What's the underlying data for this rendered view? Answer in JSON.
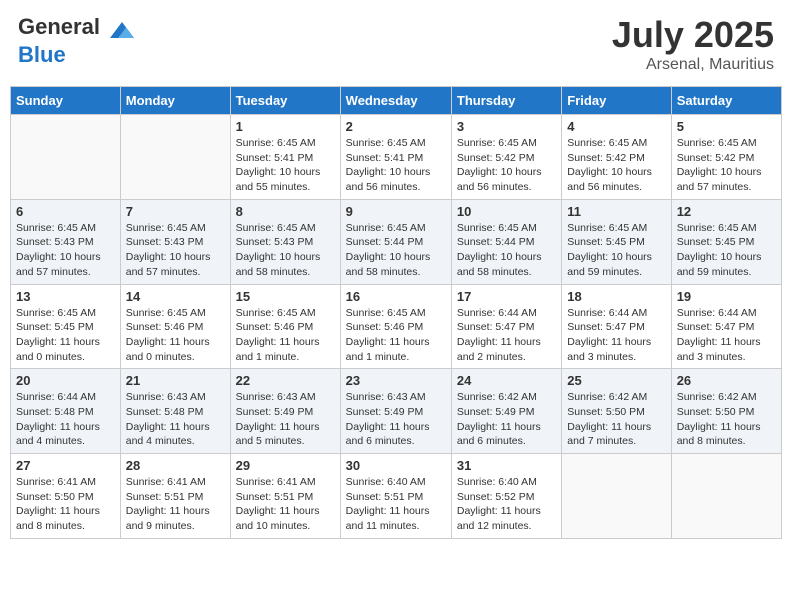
{
  "header": {
    "logo_line1": "General",
    "logo_line2": "Blue",
    "month": "July 2025",
    "location": "Arsenal, Mauritius"
  },
  "days_of_week": [
    "Sunday",
    "Monday",
    "Tuesday",
    "Wednesday",
    "Thursday",
    "Friday",
    "Saturday"
  ],
  "weeks": [
    [
      {
        "day": "",
        "info": ""
      },
      {
        "day": "",
        "info": ""
      },
      {
        "day": "1",
        "info": "Sunrise: 6:45 AM\nSunset: 5:41 PM\nDaylight: 10 hours and 55 minutes."
      },
      {
        "day": "2",
        "info": "Sunrise: 6:45 AM\nSunset: 5:41 PM\nDaylight: 10 hours and 56 minutes."
      },
      {
        "day": "3",
        "info": "Sunrise: 6:45 AM\nSunset: 5:42 PM\nDaylight: 10 hours and 56 minutes."
      },
      {
        "day": "4",
        "info": "Sunrise: 6:45 AM\nSunset: 5:42 PM\nDaylight: 10 hours and 56 minutes."
      },
      {
        "day": "5",
        "info": "Sunrise: 6:45 AM\nSunset: 5:42 PM\nDaylight: 10 hours and 57 minutes."
      }
    ],
    [
      {
        "day": "6",
        "info": "Sunrise: 6:45 AM\nSunset: 5:43 PM\nDaylight: 10 hours and 57 minutes."
      },
      {
        "day": "7",
        "info": "Sunrise: 6:45 AM\nSunset: 5:43 PM\nDaylight: 10 hours and 57 minutes."
      },
      {
        "day": "8",
        "info": "Sunrise: 6:45 AM\nSunset: 5:43 PM\nDaylight: 10 hours and 58 minutes."
      },
      {
        "day": "9",
        "info": "Sunrise: 6:45 AM\nSunset: 5:44 PM\nDaylight: 10 hours and 58 minutes."
      },
      {
        "day": "10",
        "info": "Sunrise: 6:45 AM\nSunset: 5:44 PM\nDaylight: 10 hours and 58 minutes."
      },
      {
        "day": "11",
        "info": "Sunrise: 6:45 AM\nSunset: 5:45 PM\nDaylight: 10 hours and 59 minutes."
      },
      {
        "day": "12",
        "info": "Sunrise: 6:45 AM\nSunset: 5:45 PM\nDaylight: 10 hours and 59 minutes."
      }
    ],
    [
      {
        "day": "13",
        "info": "Sunrise: 6:45 AM\nSunset: 5:45 PM\nDaylight: 11 hours and 0 minutes."
      },
      {
        "day": "14",
        "info": "Sunrise: 6:45 AM\nSunset: 5:46 PM\nDaylight: 11 hours and 0 minutes."
      },
      {
        "day": "15",
        "info": "Sunrise: 6:45 AM\nSunset: 5:46 PM\nDaylight: 11 hours and 1 minute."
      },
      {
        "day": "16",
        "info": "Sunrise: 6:45 AM\nSunset: 5:46 PM\nDaylight: 11 hours and 1 minute."
      },
      {
        "day": "17",
        "info": "Sunrise: 6:44 AM\nSunset: 5:47 PM\nDaylight: 11 hours and 2 minutes."
      },
      {
        "day": "18",
        "info": "Sunrise: 6:44 AM\nSunset: 5:47 PM\nDaylight: 11 hours and 3 minutes."
      },
      {
        "day": "19",
        "info": "Sunrise: 6:44 AM\nSunset: 5:47 PM\nDaylight: 11 hours and 3 minutes."
      }
    ],
    [
      {
        "day": "20",
        "info": "Sunrise: 6:44 AM\nSunset: 5:48 PM\nDaylight: 11 hours and 4 minutes."
      },
      {
        "day": "21",
        "info": "Sunrise: 6:43 AM\nSunset: 5:48 PM\nDaylight: 11 hours and 4 minutes."
      },
      {
        "day": "22",
        "info": "Sunrise: 6:43 AM\nSunset: 5:49 PM\nDaylight: 11 hours and 5 minutes."
      },
      {
        "day": "23",
        "info": "Sunrise: 6:43 AM\nSunset: 5:49 PM\nDaylight: 11 hours and 6 minutes."
      },
      {
        "day": "24",
        "info": "Sunrise: 6:42 AM\nSunset: 5:49 PM\nDaylight: 11 hours and 6 minutes."
      },
      {
        "day": "25",
        "info": "Sunrise: 6:42 AM\nSunset: 5:50 PM\nDaylight: 11 hours and 7 minutes."
      },
      {
        "day": "26",
        "info": "Sunrise: 6:42 AM\nSunset: 5:50 PM\nDaylight: 11 hours and 8 minutes."
      }
    ],
    [
      {
        "day": "27",
        "info": "Sunrise: 6:41 AM\nSunset: 5:50 PM\nDaylight: 11 hours and 8 minutes."
      },
      {
        "day": "28",
        "info": "Sunrise: 6:41 AM\nSunset: 5:51 PM\nDaylight: 11 hours and 9 minutes."
      },
      {
        "day": "29",
        "info": "Sunrise: 6:41 AM\nSunset: 5:51 PM\nDaylight: 11 hours and 10 minutes."
      },
      {
        "day": "30",
        "info": "Sunrise: 6:40 AM\nSunset: 5:51 PM\nDaylight: 11 hours and 11 minutes."
      },
      {
        "day": "31",
        "info": "Sunrise: 6:40 AM\nSunset: 5:52 PM\nDaylight: 11 hours and 12 minutes."
      },
      {
        "day": "",
        "info": ""
      },
      {
        "day": "",
        "info": ""
      }
    ]
  ]
}
